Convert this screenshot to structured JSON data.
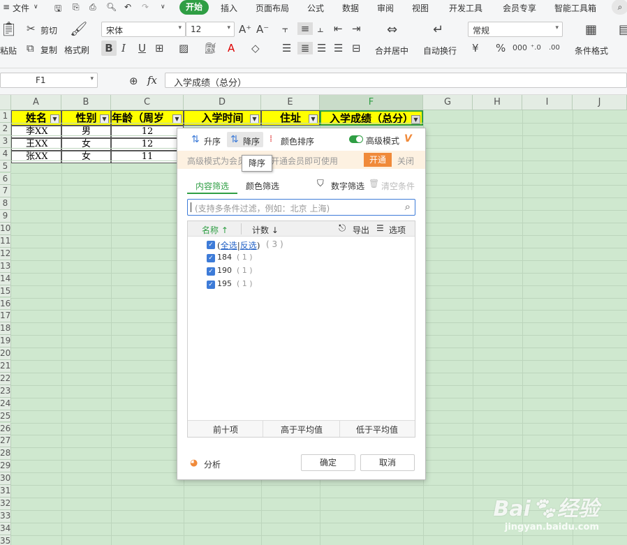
{
  "menu": {
    "file": "文件",
    "tabs": [
      "开始",
      "插入",
      "页面布局",
      "公式",
      "数据",
      "审阅",
      "视图",
      "开发工具",
      "会员专享",
      "智能工具箱"
    ]
  },
  "toolbar": {
    "paste": "粘贴",
    "cut": "剪切",
    "copy": "复制",
    "format_painter": "格式刷",
    "font": "宋体",
    "font_size": "12",
    "merge": "合并居中",
    "wrap": "自动换行",
    "number_format": "常规",
    "cond_format": "条件格式"
  },
  "formula": {
    "cell_ref": "F1",
    "fx": "fx",
    "content": "入学成绩（总分）"
  },
  "columns": [
    "A",
    "B",
    "C",
    "D",
    "E",
    "F",
    "G",
    "H",
    "I",
    "J"
  ],
  "rows": [
    "1",
    "2",
    "3",
    "4",
    "5",
    "6",
    "7",
    "8",
    "9",
    "10",
    "11",
    "12",
    "13",
    "14",
    "15",
    "16",
    "17",
    "18",
    "19",
    "20",
    "21",
    "22",
    "23",
    "24",
    "25",
    "26",
    "27",
    "28",
    "29",
    "30",
    "31",
    "32",
    "33",
    "34",
    "35"
  ],
  "headers": [
    "姓名",
    "性别",
    "年龄（周岁",
    "入学时间",
    "住址",
    "入学成绩（总分）"
  ],
  "data": [
    [
      "李XX",
      "男",
      "12"
    ],
    [
      "王XX",
      "女",
      "12"
    ],
    [
      "张XX",
      "女",
      "11"
    ]
  ],
  "filter": {
    "asc": "升序",
    "desc": "降序",
    "color_sort": "颜色排序",
    "advanced": "高级模式",
    "tooltip": "降序",
    "banner": "高级模式为会员",
    "banner2": "开通会员即可使用",
    "open": "开通",
    "close": "关闭",
    "tab_content": "内容筛选",
    "tab_color": "颜色筛选",
    "number_filter": "数字筛选",
    "clear": "清空条件",
    "search_placeholder": "(支持多条件过滤，例如：北京 上海)",
    "col_name": "名称",
    "col_count": "计数",
    "export": "导出",
    "options": "选项",
    "select_all": "全选",
    "invert": "反选",
    "all_count": "( 3 )",
    "items": [
      {
        "label": "184",
        "count": "( 1 )"
      },
      {
        "label": "190",
        "count": "( 1 )"
      },
      {
        "label": "195",
        "count": "( 1 )"
      }
    ],
    "top10": "前十项",
    "above_avg": "高于平均值",
    "below_avg": "低于平均值",
    "analysis": "分析",
    "ok": "确定",
    "cancel": "取消"
  },
  "watermark": {
    "brand": "Bai",
    "brand2": "经验",
    "url": "jingyan.baidu.com"
  },
  "colors": {
    "accent": "#2f9e44",
    "header_fill": "#ffff00",
    "grid_bg": "#cfe8cf",
    "orange": "#f08a3a"
  }
}
